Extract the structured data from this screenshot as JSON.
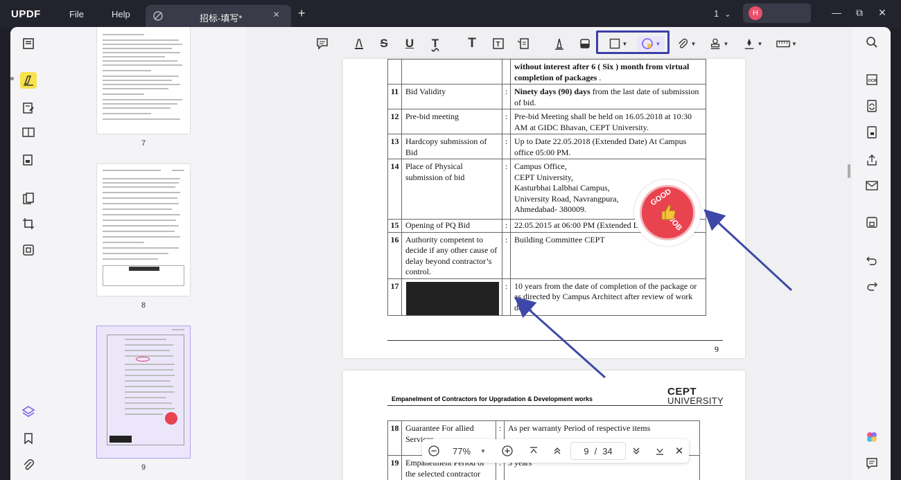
{
  "titlebar": {
    "logo": "UPDF",
    "menu_file": "File",
    "menu_help": "Help",
    "tab_title": "招标-填写*",
    "tab_close": "×",
    "new_tab": "+",
    "page_indicator": "1",
    "avatar_initial": "H"
  },
  "thumbnails": [
    {
      "num": "7"
    },
    {
      "num": "8"
    },
    {
      "num": "9"
    }
  ],
  "document": {
    "page1_rows": [
      {
        "no": "",
        "label": "",
        "colon": "",
        "detail_bold": "without interest after 6 ( Six ) month from virtual completion of packages",
        "detail": " ."
      },
      {
        "no": "11",
        "label": "Bid Validity",
        "colon": ":",
        "detail_bold": "Ninety days (90) days",
        "detail": " from the last date of submission of bid."
      },
      {
        "no": "12",
        "label": "Pre-bid meeting",
        "colon": ":",
        "detail_bold": "",
        "detail": "Pre-bid Meeting shall be held on 16.05.2018 at 10:30 AM at GIDC Bhavan, CEPT University."
      },
      {
        "no": "13",
        "label": "Hardcopy submission of Bid",
        "colon": ":",
        "detail_bold": "",
        "detail": "Up to Date 22.05.2018 (Extended Date) At Campus office 05:00 PM."
      },
      {
        "no": "14",
        "label": "Place of Physical submission of bid",
        "colon": ":",
        "detail_bold": "",
        "detail": "Campus Office,\nCEPT University,\nKasturbhai Lalbhai Campus,\nUniversity Road, Navrangpura,\nAhmedabad- 380009."
      },
      {
        "no": "15",
        "label": "Opening of PQ Bid",
        "colon": ":",
        "detail_bold": "",
        "detail": "22.05.2015 at 06:00 PM (Extended Date)"
      },
      {
        "no": "16",
        "label": "Authority competent to decide if any other cause of delay beyond contractor’s control.",
        "colon": ":",
        "detail_bold": "",
        "detail": "Building Committee CEPT"
      },
      {
        "no": "17",
        "label": "",
        "colon": ":",
        "detail_bold": "",
        "detail": "10 years from the date of completion of the package or as directed by Campus Architect after review of work done."
      }
    ],
    "page1_footer_num": "9",
    "stamp_text_top": "GOOD",
    "stamp_text_bottom": "JOB",
    "page2_header": "Empanelment of Contractors for Upgradation & Development works",
    "page2_logo_line1": "CEPT",
    "page2_logo_line2": "UNIVERSITY",
    "page2_rows": [
      {
        "no": "18",
        "label": "Guarantee For allied Services",
        "colon": ":",
        "detail": "As per warranty Period of respective items"
      },
      {
        "no": "19",
        "label": "Empanelment Period of the selected contractor",
        "colon": ":",
        "detail": "3 years"
      }
    ]
  },
  "zoom": {
    "level": "77%",
    "current_page": "9",
    "separator": "/",
    "total_pages": "34"
  },
  "colors": {
    "accent_yellow": "#f7e24a",
    "highlight_box": "#3b3fa7",
    "arrow": "#3e48a8",
    "stamp_red": "#e8434f"
  }
}
